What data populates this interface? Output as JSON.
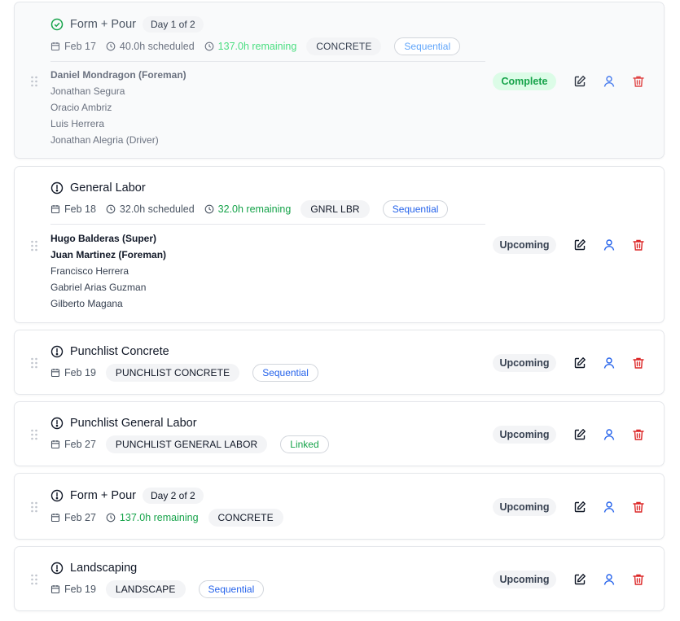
{
  "colors": {
    "complete_green": "#16a34a",
    "remaining_green": "#16a34a",
    "link_blue": "#2563eb",
    "delete_red": "#dc2626",
    "pill_gray": "#f3f4f6"
  },
  "tasks": [
    {
      "title": "Form + Pour",
      "day_label": "Day 1 of 2",
      "status_icon": "check-circle-icon",
      "date": "Feb 17",
      "scheduled": "40.0h scheduled",
      "remaining": "137.0h remaining",
      "tag": "CONCRETE",
      "mode": "Sequential",
      "status": "Complete",
      "crew": [
        {
          "name": "Daniel Mondragon (Foreman)",
          "lead": true
        },
        {
          "name": "Jonathan Segura",
          "lead": false
        },
        {
          "name": "Oracio Ambriz",
          "lead": false
        },
        {
          "name": "Luis Herrera",
          "lead": false
        },
        {
          "name": "Jonathan Alegria (Driver)",
          "lead": false
        }
      ]
    },
    {
      "title": "General Labor",
      "status_icon": "alert-circle-icon",
      "date": "Feb 18",
      "scheduled": "32.0h scheduled",
      "remaining": "32.0h remaining",
      "tag": "GNRL LBR",
      "mode": "Sequential",
      "status": "Upcoming",
      "crew": [
        {
          "name": "Hugo Balderas (Super)",
          "lead": true
        },
        {
          "name": "Juan Martinez (Foreman)",
          "lead": true
        },
        {
          "name": "Francisco Herrera",
          "lead": false
        },
        {
          "name": "Gabriel Arias Guzman",
          "lead": false
        },
        {
          "name": "Gilberto Magana",
          "lead": false
        }
      ]
    },
    {
      "title": "Punchlist Concrete",
      "status_icon": "alert-circle-icon",
      "date": "Feb 19",
      "tag": "PUNCHLIST CONCRETE",
      "mode": "Sequential",
      "status": "Upcoming"
    },
    {
      "title": "Punchlist General Labor",
      "status_icon": "alert-circle-icon",
      "date": "Feb 27",
      "tag": "PUNCHLIST GENERAL LABOR",
      "mode": "Linked",
      "status": "Upcoming"
    },
    {
      "title": "Form + Pour",
      "day_label": "Day 2 of 2",
      "status_icon": "alert-circle-icon",
      "date": "Feb 27",
      "remaining": "137.0h remaining",
      "tag": "CONCRETE",
      "status": "Upcoming"
    },
    {
      "title": "Landscaping",
      "status_icon": "alert-circle-icon",
      "date": "Feb 19",
      "tag": "LANDSCAPE",
      "mode": "Sequential",
      "status": "Upcoming"
    }
  ]
}
